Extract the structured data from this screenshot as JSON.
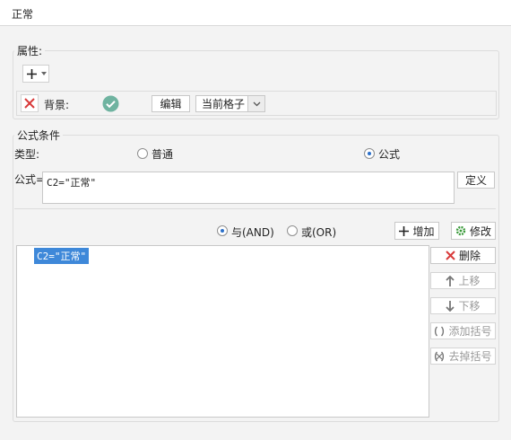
{
  "window": {
    "title": "正常"
  },
  "attributes": {
    "legend": "属性:",
    "background_label": "背景:",
    "edit_label": "编辑",
    "scope_value": "当前格子"
  },
  "condition": {
    "legend": "公式条件",
    "type_label": "类型:",
    "type_normal": "普通",
    "type_formula": "公式",
    "formula_label": "公式=",
    "formula_value": "C2=\"正常\"",
    "define_label": "定义",
    "and_label": "与(AND)",
    "or_label": "或(OR)",
    "add_label": "增加",
    "modify_label": "修改",
    "list_items": [
      "C2=\"正常\""
    ],
    "delete_label": "删除",
    "move_up_label": "上移",
    "move_down_label": "下移",
    "add_bracket_label": "添加括号",
    "remove_bracket_label": "去掉括号"
  },
  "colors": {
    "accent": "#2b70c9",
    "delete_red": "#d83a3a",
    "check_green": "#6fb3a0"
  }
}
